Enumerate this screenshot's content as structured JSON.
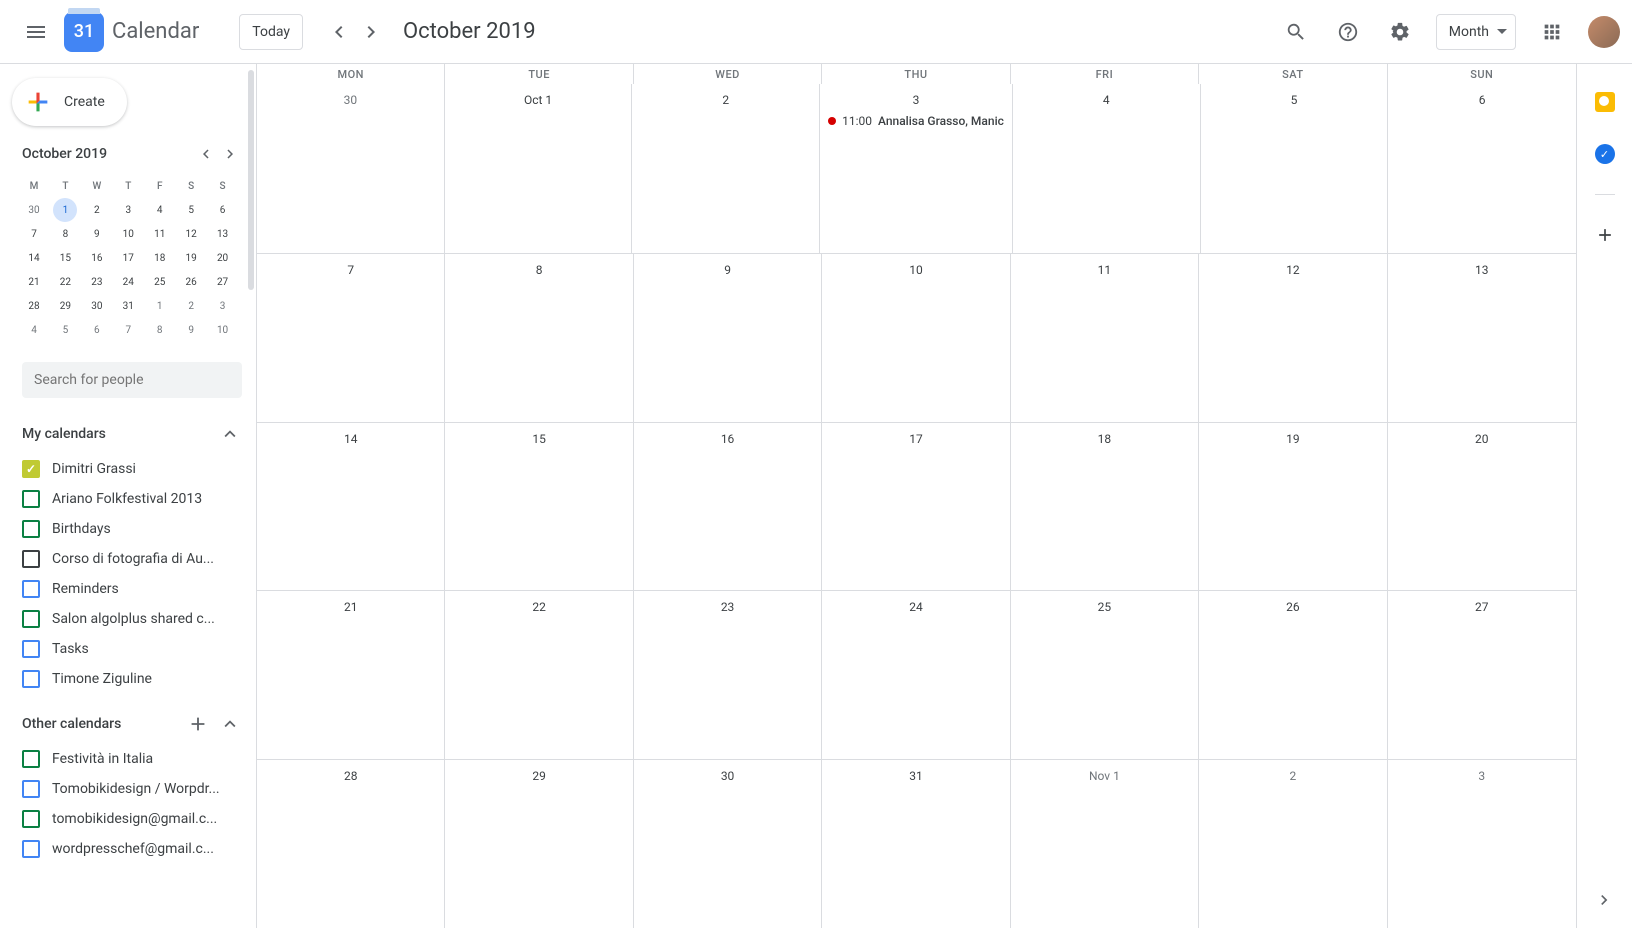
{
  "logo": {
    "day": "31",
    "text": "Calendar"
  },
  "header": {
    "today": "Today",
    "title": "October 2019",
    "view": "Month"
  },
  "mini": {
    "title": "October 2019",
    "dow": [
      "M",
      "T",
      "W",
      "T",
      "F",
      "S",
      "S"
    ],
    "rows": [
      [
        {
          "n": "30",
          "o": true
        },
        {
          "n": "1",
          "o": false,
          "today": true
        },
        {
          "n": "2",
          "o": false
        },
        {
          "n": "3",
          "o": false
        },
        {
          "n": "4",
          "o": false
        },
        {
          "n": "5",
          "o": false
        },
        {
          "n": "6",
          "o": false
        }
      ],
      [
        {
          "n": "7",
          "o": false
        },
        {
          "n": "8",
          "o": false
        },
        {
          "n": "9",
          "o": false
        },
        {
          "n": "10",
          "o": false
        },
        {
          "n": "11",
          "o": false
        },
        {
          "n": "12",
          "o": false
        },
        {
          "n": "13",
          "o": false
        }
      ],
      [
        {
          "n": "14",
          "o": false
        },
        {
          "n": "15",
          "o": false
        },
        {
          "n": "16",
          "o": false
        },
        {
          "n": "17",
          "o": false
        },
        {
          "n": "18",
          "o": false
        },
        {
          "n": "19",
          "o": false
        },
        {
          "n": "20",
          "o": false
        }
      ],
      [
        {
          "n": "21",
          "o": false
        },
        {
          "n": "22",
          "o": false
        },
        {
          "n": "23",
          "o": false
        },
        {
          "n": "24",
          "o": false
        },
        {
          "n": "25",
          "o": false
        },
        {
          "n": "26",
          "o": false
        },
        {
          "n": "27",
          "o": false
        }
      ],
      [
        {
          "n": "28",
          "o": false
        },
        {
          "n": "29",
          "o": false
        },
        {
          "n": "30",
          "o": false
        },
        {
          "n": "31",
          "o": false
        },
        {
          "n": "1",
          "o": true
        },
        {
          "n": "2",
          "o": true
        },
        {
          "n": "3",
          "o": true
        }
      ],
      [
        {
          "n": "4",
          "o": true
        },
        {
          "n": "5",
          "o": true
        },
        {
          "n": "6",
          "o": true
        },
        {
          "n": "7",
          "o": true
        },
        {
          "n": "8",
          "o": true
        },
        {
          "n": "9",
          "o": true
        },
        {
          "n": "10",
          "o": true
        }
      ]
    ]
  },
  "search": {
    "placeholder": "Search for people"
  },
  "create": "Create",
  "myCal": {
    "title": "My calendars",
    "items": [
      {
        "label": "Dimitri Grassi",
        "color": "#c0ca33",
        "checked": true
      },
      {
        "label": "Ariano Folkfestival 2013",
        "color": "#0b8043",
        "checked": false
      },
      {
        "label": "Birthdays",
        "color": "#0b8043",
        "checked": false
      },
      {
        "label": "Corso di fotografia di Au...",
        "color": "#3c4043",
        "checked": false
      },
      {
        "label": "Reminders",
        "color": "#4285f4",
        "checked": false
      },
      {
        "label": "Salon algolplus shared c...",
        "color": "#0b8043",
        "checked": false
      },
      {
        "label": "Tasks",
        "color": "#4285f4",
        "checked": false
      },
      {
        "label": "Timone Ziguline",
        "color": "#4285f4",
        "checked": false
      }
    ]
  },
  "otherCal": {
    "title": "Other calendars",
    "items": [
      {
        "label": "Festività in Italia",
        "color": "#0b8043",
        "checked": false
      },
      {
        "label": "Tomobikidesign / Worpdr...",
        "color": "#4285f4",
        "checked": false
      },
      {
        "label": "tomobikidesign@gmail.c...",
        "color": "#0b8043",
        "checked": false
      },
      {
        "label": "wordpresschef@gmail.c...",
        "color": "#4285f4",
        "checked": false
      }
    ]
  },
  "dow": [
    "MON",
    "TUE",
    "WED",
    "THU",
    "FRI",
    "SAT",
    "SUN"
  ],
  "weeks": [
    [
      {
        "n": "30",
        "o": true
      },
      {
        "n": "Oct 1"
      },
      {
        "n": "2"
      },
      {
        "n": "3",
        "event": {
          "time": "11:00",
          "title": "Annalisa Grasso, Manic"
        }
      },
      {
        "n": "4"
      },
      {
        "n": "5"
      },
      {
        "n": "6"
      }
    ],
    [
      {
        "n": "7"
      },
      {
        "n": "8"
      },
      {
        "n": "9"
      },
      {
        "n": "10"
      },
      {
        "n": "11"
      },
      {
        "n": "12"
      },
      {
        "n": "13"
      }
    ],
    [
      {
        "n": "14"
      },
      {
        "n": "15"
      },
      {
        "n": "16"
      },
      {
        "n": "17"
      },
      {
        "n": "18"
      },
      {
        "n": "19"
      },
      {
        "n": "20"
      }
    ],
    [
      {
        "n": "21"
      },
      {
        "n": "22"
      },
      {
        "n": "23"
      },
      {
        "n": "24"
      },
      {
        "n": "25"
      },
      {
        "n": "26"
      },
      {
        "n": "27"
      }
    ],
    [
      {
        "n": "28"
      },
      {
        "n": "29"
      },
      {
        "n": "30"
      },
      {
        "n": "31"
      },
      {
        "n": "Nov 1",
        "o": true
      },
      {
        "n": "2",
        "o": true
      },
      {
        "n": "3",
        "o": true
      }
    ]
  ]
}
